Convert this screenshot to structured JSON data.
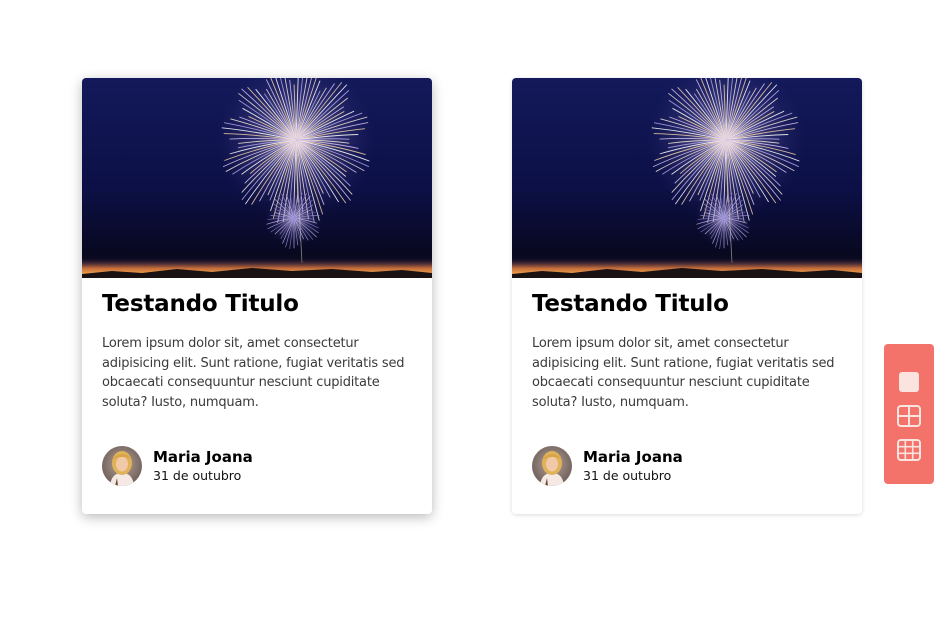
{
  "cards": [
    {
      "image": "fireworks-night-sky",
      "title": "Testando Titulo",
      "text": "Lorem ipsum dolor sit, amet consectetur adipisicing elit. Sunt ratione, fugiat veritatis sed obcaecati consequuntur nesciunt cupiditate soluta? Iusto, numquam.",
      "author": {
        "name": "Maria Joana",
        "date": "31 de outubro",
        "avatar": "avatar-woman-blonde"
      }
    },
    {
      "image": "fireworks-night-sky",
      "title": "Testando Titulo",
      "text": "Lorem ipsum dolor sit, amet consectetur adipisicing elit. Sunt ratione, fugiat veritatis sed obcaecati consequuntur nesciunt cupiditate soluta? Iusto, numquam.",
      "author": {
        "name": "Maria Joana",
        "date": "31 de outubro",
        "avatar": "avatar-woman-blonde"
      }
    }
  ],
  "view_toggle": {
    "buttons": [
      {
        "icon": "single-column-icon"
      },
      {
        "icon": "two-column-grid-icon"
      },
      {
        "icon": "three-column-grid-icon"
      }
    ]
  },
  "colors": {
    "toggle_background": "#f3736a",
    "sky_top": "#10163f",
    "sky_bottom": "#0a0a25",
    "horizon_glow": "#e8893a"
  }
}
